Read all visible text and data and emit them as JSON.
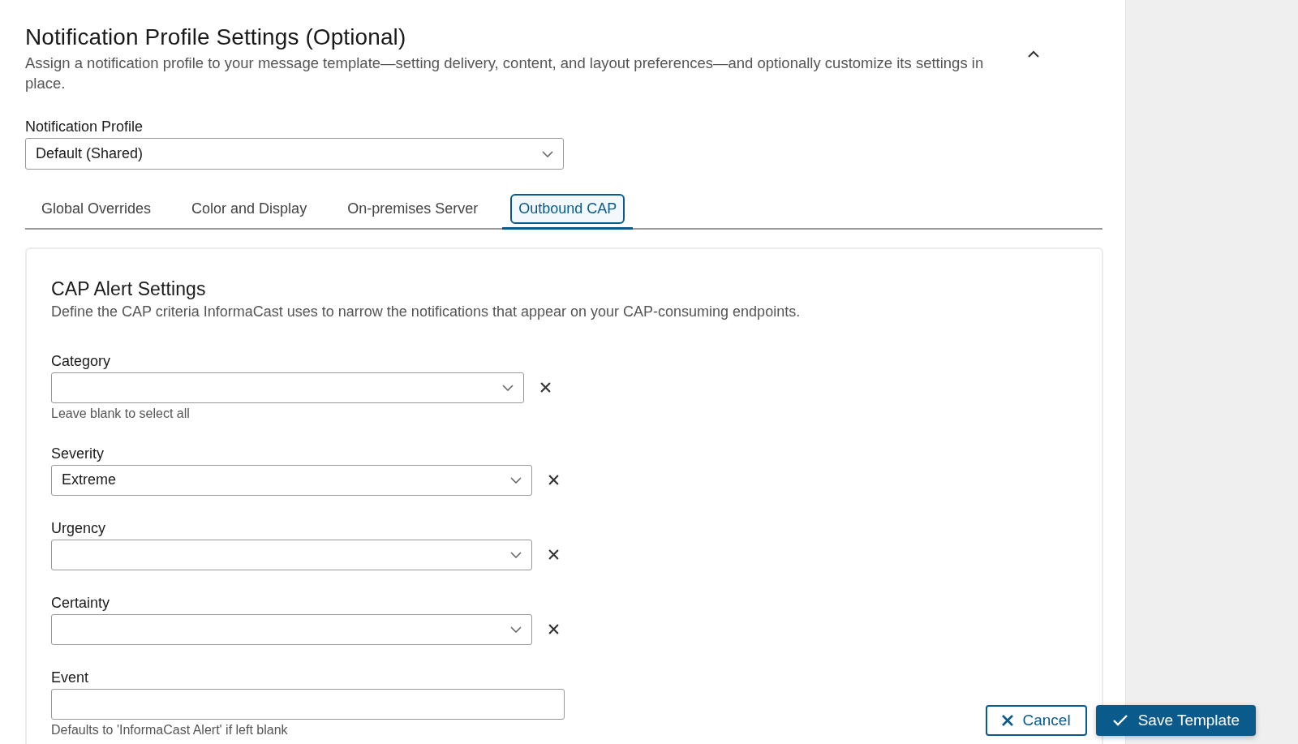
{
  "section": {
    "title": "Notification Profile Settings (Optional)",
    "description": "Assign a notification profile to your message template—setting delivery, content, and layout preferences—and optionally customize its settings in place.",
    "expanded": true
  },
  "profile": {
    "label": "Notification Profile",
    "value": "Default (Shared)"
  },
  "tabs": [
    {
      "label": "Global Overrides",
      "selected": false
    },
    {
      "label": "Color and Display",
      "selected": false
    },
    {
      "label": "On-premises Server",
      "selected": false
    },
    {
      "label": "Outbound CAP",
      "selected": true
    }
  ],
  "card": {
    "title": "CAP Alert Settings",
    "description": "Define the CAP criteria InformaCast uses to narrow the notifications that appear on your CAP-consuming endpoints."
  },
  "fields": [
    {
      "kind": "select",
      "label": "Category",
      "hint": "Leave blank to select all"
    },
    {
      "kind": "select",
      "label": "Severity",
      "value": "Extreme"
    },
    {
      "kind": "select",
      "label": "Urgency"
    },
    {
      "kind": "select",
      "label": "Certainty"
    },
    {
      "kind": "text",
      "label": "Event",
      "hint": "Defaults to 'InformaCast Alert' if left blank"
    }
  ],
  "buttons": [
    {
      "kind": "secondary",
      "label": "Cancel"
    },
    {
      "kind": "primary",
      "label": "Save Template"
    }
  ]
}
